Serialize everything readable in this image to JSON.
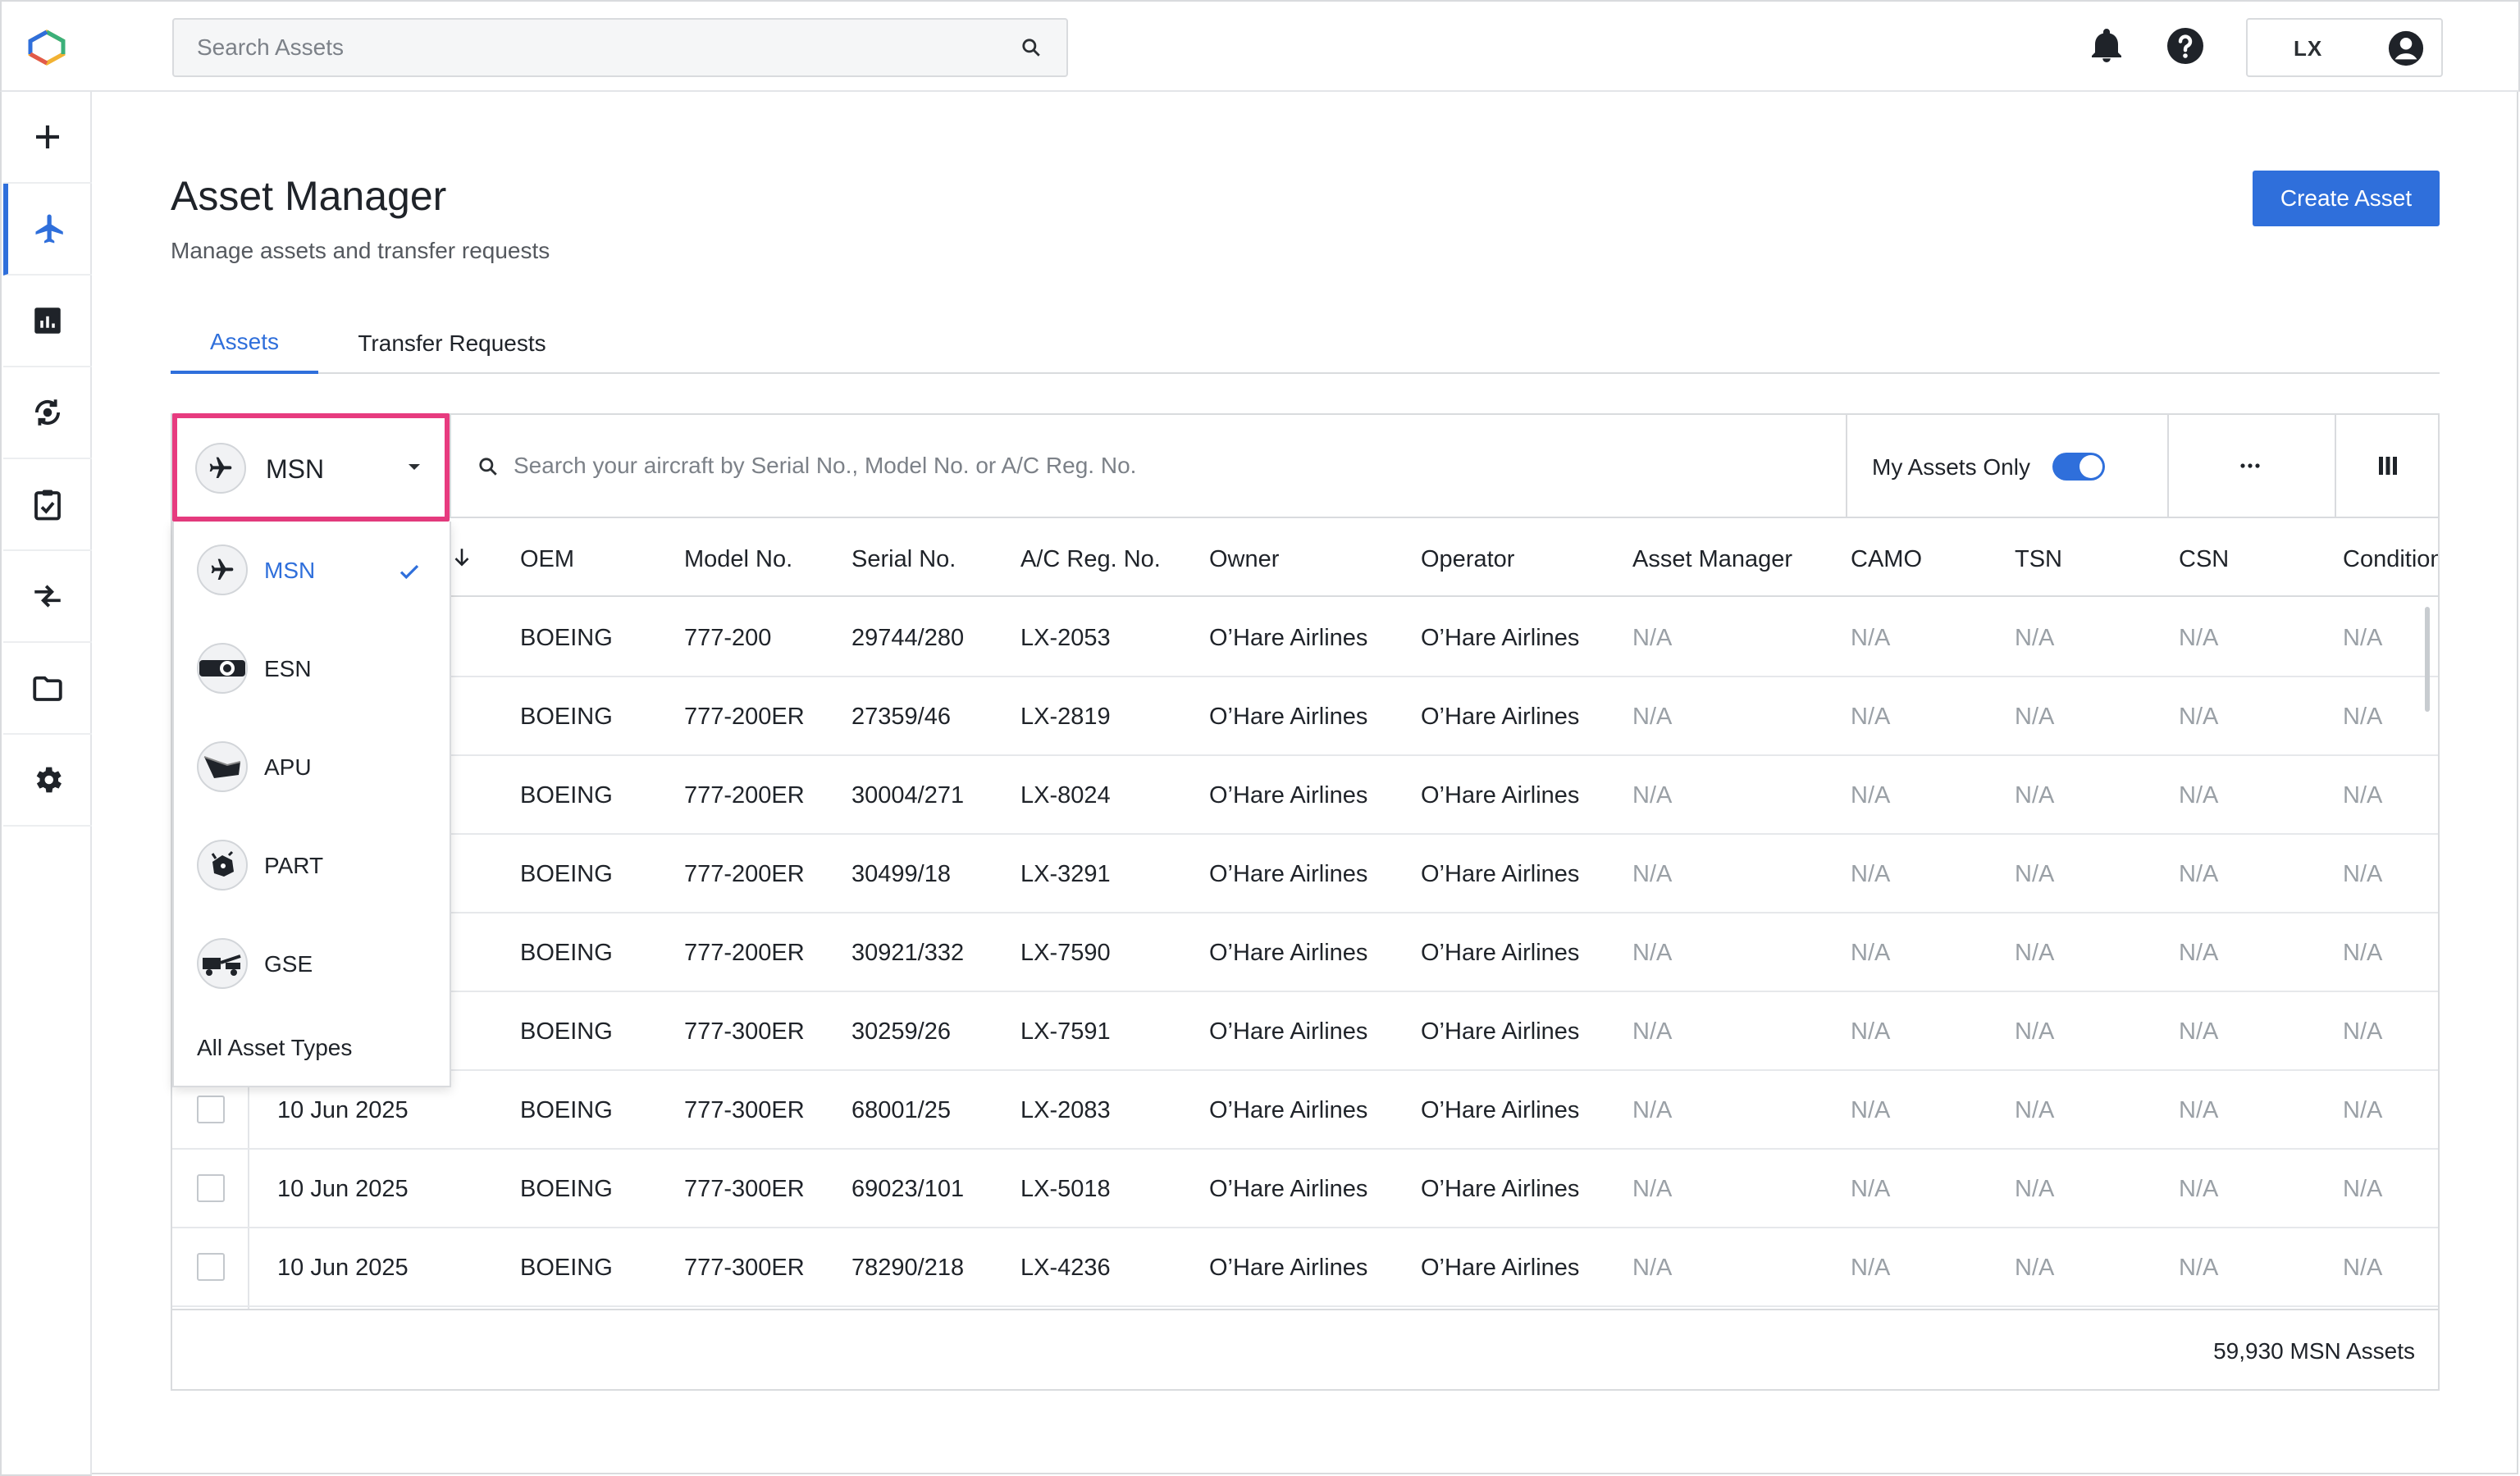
{
  "topbar": {
    "search_placeholder": "Search Assets",
    "user_initials": "LX",
    "icons": [
      "logo",
      "search-icon",
      "bell-icon",
      "help-icon",
      "account-icon"
    ]
  },
  "sidebar": {
    "items": [
      {
        "name": "add",
        "icon": "plus-icon",
        "active": false
      },
      {
        "name": "assets",
        "icon": "airplane-icon",
        "active": true
      },
      {
        "name": "reports",
        "icon": "chart-icon",
        "active": false
      },
      {
        "name": "sync",
        "icon": "sync-icon",
        "active": false
      },
      {
        "name": "tasks",
        "icon": "clipboard-check-icon",
        "active": false
      },
      {
        "name": "transfers",
        "icon": "transfer-icon",
        "active": false
      },
      {
        "name": "files",
        "icon": "folder-icon",
        "active": false
      },
      {
        "name": "settings",
        "icon": "gear-icon",
        "active": false
      }
    ],
    "accent": "#2f6fdb"
  },
  "page": {
    "title": "Asset Manager",
    "subtitle": "Manage assets and transfer requests",
    "create_button": "Create Asset"
  },
  "tabs": [
    {
      "label": "Assets",
      "active": true
    },
    {
      "label": "Transfer Requests",
      "active": false
    }
  ],
  "toolbar": {
    "asset_type_value": "MSN",
    "search_placeholder": "Search your aircraft by Serial No., Model No. or A/C Reg. No.",
    "my_assets_label": "My Assets Only",
    "my_assets_on": true
  },
  "dropdown": {
    "items": [
      {
        "label": "MSN",
        "icon": "airplane-icon",
        "selected": true
      },
      {
        "label": "ESN",
        "icon": "engine-icon",
        "selected": false
      },
      {
        "label": "APU",
        "icon": "apu-icon",
        "selected": false
      },
      {
        "label": "PART",
        "icon": "part-icon",
        "selected": false
      },
      {
        "label": "GSE",
        "icon": "ground-vehicle-icon",
        "selected": false
      }
    ],
    "all_label": "All Asset Types"
  },
  "table": {
    "columns": [
      "OEM",
      "Model No.",
      "Serial No.",
      "A/C Reg. No.",
      "Owner",
      "Operator",
      "Asset Manager",
      "CAMO",
      "TSN",
      "CSN",
      "Condition"
    ],
    "rows": [
      {
        "date": "",
        "oem": "BOEING",
        "model": "777-200",
        "serial": "29744/280",
        "reg": "LX-2053",
        "owner": "O’Hare Airlines",
        "operator": "O’Hare Airlines",
        "manager": "N/A",
        "camo": "N/A",
        "tsn": "N/A",
        "csn": "N/A",
        "condition": "N/A"
      },
      {
        "date": "",
        "oem": "BOEING",
        "model": "777-200ER",
        "serial": "27359/46",
        "reg": "LX-2819",
        "owner": "O’Hare Airlines",
        "operator": "O’Hare Airlines",
        "manager": "N/A",
        "camo": "N/A",
        "tsn": "N/A",
        "csn": "N/A",
        "condition": "N/A"
      },
      {
        "date": "",
        "oem": "BOEING",
        "model": "777-200ER",
        "serial": "30004/271",
        "reg": "LX-8024",
        "owner": "O’Hare Airlines",
        "operator": "O’Hare Airlines",
        "manager": "N/A",
        "camo": "N/A",
        "tsn": "N/A",
        "csn": "N/A",
        "condition": "N/A"
      },
      {
        "date": "",
        "oem": "BOEING",
        "model": "777-200ER",
        "serial": "30499/18",
        "reg": "LX-3291",
        "owner": "O’Hare Airlines",
        "operator": "O’Hare Airlines",
        "manager": "N/A",
        "camo": "N/A",
        "tsn": "N/A",
        "csn": "N/A",
        "condition": "N/A"
      },
      {
        "date": "",
        "oem": "BOEING",
        "model": "777-200ER",
        "serial": "30921/332",
        "reg": "LX-7590",
        "owner": "O’Hare Airlines",
        "operator": "O’Hare Airlines",
        "manager": "N/A",
        "camo": "N/A",
        "tsn": "N/A",
        "csn": "N/A",
        "condition": "N/A"
      },
      {
        "date": "",
        "oem": "BOEING",
        "model": "777-300ER",
        "serial": "30259/26",
        "reg": "LX-7591",
        "owner": "O’Hare Airlines",
        "operator": "O’Hare Airlines",
        "manager": "N/A",
        "camo": "N/A",
        "tsn": "N/A",
        "csn": "N/A",
        "condition": "N/A"
      },
      {
        "date": "10 Jun 2025",
        "oem": "BOEING",
        "model": "777-300ER",
        "serial": "68001/25",
        "reg": "LX-2083",
        "owner": "O’Hare Airlines",
        "operator": "O’Hare Airlines",
        "manager": "N/A",
        "camo": "N/A",
        "tsn": "N/A",
        "csn": "N/A",
        "condition": "N/A"
      },
      {
        "date": "10 Jun 2025",
        "oem": "BOEING",
        "model": "777-300ER",
        "serial": "69023/101",
        "reg": "LX-5018",
        "owner": "O’Hare Airlines",
        "operator": "O’Hare Airlines",
        "manager": "N/A",
        "camo": "N/A",
        "tsn": "N/A",
        "csn": "N/A",
        "condition": "N/A"
      },
      {
        "date": "10 Jun 2025",
        "oem": "BOEING",
        "model": "777-300ER",
        "serial": "78290/218",
        "reg": "LX-4236",
        "owner": "O’Hare Airlines",
        "operator": "O’Hare Airlines",
        "manager": "N/A",
        "camo": "N/A",
        "tsn": "N/A",
        "csn": "N/A",
        "condition": "N/A"
      }
    ],
    "footer_count": "59,930 MSN Assets"
  },
  "colors": {
    "accent": "#2f6fdb",
    "highlight": "#e73b7f",
    "muted": "#9aa0a6"
  }
}
